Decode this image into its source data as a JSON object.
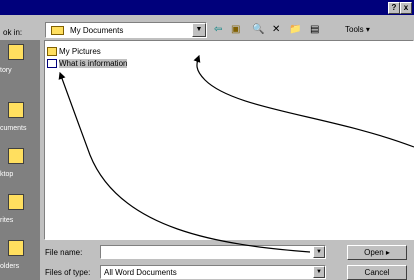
{
  "title_bar": {
    "help_label": "?",
    "close_label": "x"
  },
  "toolbar": {
    "look_in_label": "ok in:",
    "look_in_value": "My Documents",
    "dropdown_glyph": "▼",
    "back_icon": "⇦",
    "up_icon": "▣",
    "search_web_icon": "🔍",
    "delete_icon": "✕",
    "new_folder_icon": "📁",
    "views_icon": "▤",
    "tools_menu_label": "Tools ▾"
  },
  "places_bar": {
    "items": [
      {
        "label": "tory"
      },
      {
        "label": "cuments"
      },
      {
        "label": "ktop"
      },
      {
        "label": "rites"
      },
      {
        "label": "olders"
      }
    ]
  },
  "file_list": {
    "items": [
      {
        "name": "My Pictures",
        "type": "folder",
        "selected": false
      },
      {
        "name": "What is information",
        "type": "document",
        "selected": true
      }
    ]
  },
  "file_name": {
    "label": "File name:",
    "value": ""
  },
  "files_of_type": {
    "label": "Files of type:",
    "value": "All Word Documents"
  },
  "buttons": {
    "open_label": "Open ▸",
    "cancel_label": "Cancel"
  },
  "colors": {
    "title_bg": "#00007b",
    "face": "#c0c0c0",
    "places_bg": "#808080"
  }
}
